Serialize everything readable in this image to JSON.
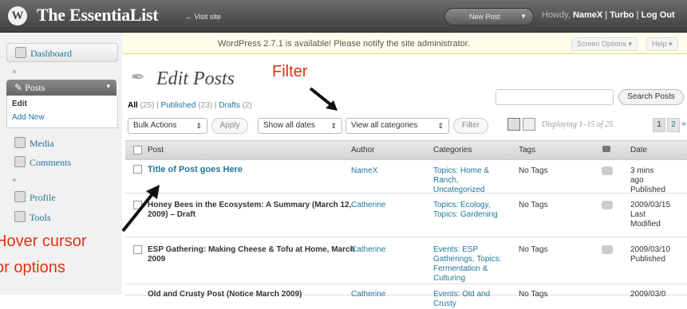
{
  "header": {
    "site_title": "The EssentiaList",
    "visit_site": "← Visit site",
    "new_post": "New Post",
    "howdy_prefix": "Howdy,",
    "user": "NameX",
    "turbo": "Turbo",
    "log_out": "Log Out"
  },
  "sidebar": {
    "dashboard": "Dashboard",
    "posts": "Posts",
    "edit": "Edit",
    "add_new": "Add New",
    "media": "Media",
    "comments": "Comments",
    "profile": "Profile",
    "tools": "Tools"
  },
  "notice": "WordPress 2.7.1 is available! Please notify the site administrator.",
  "screen_options": "Screen Options ▾",
  "help": "Help ▾",
  "page_title": "Edit Posts",
  "filters": {
    "all": "All",
    "all_count": "(25)",
    "published": "Published",
    "published_count": "(23)",
    "drafts": "Drafts",
    "drafts_count": "(2)",
    "sep": "|"
  },
  "search_button": "Search Posts",
  "bulk_actions": "Bulk Actions",
  "apply": "Apply",
  "dates": "Show all dates",
  "categories": "View all categories",
  "filter_button": "Filter",
  "displaying": "Displaying 1–15 of 25",
  "pages": [
    "1",
    "2",
    "»"
  ],
  "table": {
    "headers": {
      "post": "Post",
      "author": "Author",
      "categories": "Categories",
      "tags": "Tags",
      "date": "Date"
    },
    "rows": [
      {
        "title": "Title of Post goes Here",
        "author": "NameX",
        "categories": "Topics: Home & Ranch, Uncategorized",
        "tags": "No Tags",
        "date": "3 mins ago Published"
      },
      {
        "title": "Honey Bees in the Ecosystem: A Summary (March 12, 2009) – Draft",
        "author": "Catherine",
        "categories": "Topics: Ecology, Topics: Gardening",
        "tags": "No Tags",
        "date": "2009/03/15 Last Modified"
      },
      {
        "title": "ESP Gathering: Making Cheese & Tofu at Home, March 2009",
        "author": "Catherine",
        "categories": "Events: ESP Gatherings, Topics: Fermentation & Culturing",
        "tags": "No Tags",
        "date": "2009/03/10 Published"
      },
      {
        "title": "Old and Crusty Post (Notice March 2009)",
        "author": "Catherine",
        "categories": "Events: Old and Crusty",
        "tags": "No Tags",
        "date": "2009/03/0"
      }
    ]
  },
  "annotations": {
    "filter": "Filter",
    "hover_1": "Hover cursor",
    "hover_2": "or options"
  },
  "colors": {
    "annotation": "#e8300e",
    "link": "#21759b",
    "header": "#464646"
  }
}
